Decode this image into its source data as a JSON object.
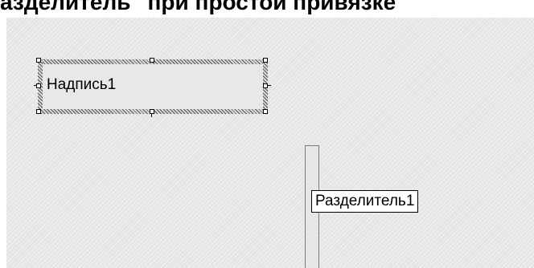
{
  "caption": "азделитель\" при простой привязке\"",
  "label_control": {
    "text": "Надпись1"
  },
  "splitter_control": {
    "tooltip": "Разделитель1"
  }
}
